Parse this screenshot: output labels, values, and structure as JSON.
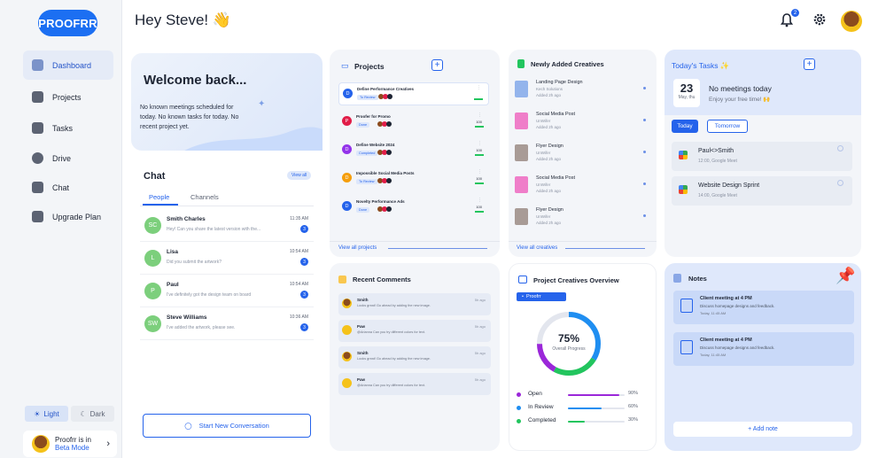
{
  "brand": {
    "logo": "PROOFRR",
    "accent": "#1c6ff2"
  },
  "header": {
    "greeting": "Hey Steve! 👋",
    "notif_count": "2"
  },
  "sidebar": {
    "items": [
      {
        "label": "Dashboard",
        "icon": "dashboard-icon",
        "active": true
      },
      {
        "label": "Projects",
        "icon": "projects-icon"
      },
      {
        "label": "Tasks",
        "icon": "tasks-icon"
      },
      {
        "label": "Drive",
        "icon": "drive-icon"
      },
      {
        "label": "Chat",
        "icon": "chat-icon"
      },
      {
        "label": "Upgrade Plan",
        "icon": "upgrade-icon"
      }
    ],
    "light": "Light",
    "dark": "Dark",
    "beta_line1": "Proofrr is in",
    "beta_line2": "Beta Mode"
  },
  "welcome": {
    "title": "Welcome back...",
    "body": "No known meetings scheduled for today. No known tasks for today. No recent project yet."
  },
  "chat": {
    "title": "Chat",
    "view_all": "View all",
    "tabs": [
      "People",
      "Channels"
    ],
    "messages": [
      {
        "initials": "SC",
        "name": "Smith Charles",
        "text": "Hey! Can you share the latest version with the...",
        "time": "11:35 AM",
        "count": "3",
        "color": "#7ccf7c"
      },
      {
        "initials": "L",
        "name": "Lisa",
        "text": "Did you submit the artwork?",
        "time": "10:54 AM",
        "count": "3",
        "color": "#7ccf7c"
      },
      {
        "initials": "P",
        "name": "Paul",
        "text": "I've definitely got the design team on board",
        "time": "10:54 AM",
        "count": "3",
        "color": "#7ccf7c"
      },
      {
        "initials": "SW",
        "name": "Steve Williams",
        "text": "I've added the artwork, please see.",
        "time": "10:36 AM",
        "count": "3",
        "color": "#7ccf7c"
      }
    ],
    "new_conv": "Start New Conversation"
  },
  "projects": {
    "title": "Projects",
    "view_all": "View all projects",
    "items": [
      {
        "initial": "D",
        "name": "Define Performance Creatives",
        "tag": "To Review",
        "color": "#2563eb",
        "value": ""
      },
      {
        "initial": "P",
        "name": "Proofer for Promo",
        "tag": "Done",
        "color": "#e11d48",
        "value": "100"
      },
      {
        "initial": "D",
        "name": "Define Website 2024",
        "tag": "Completed",
        "color": "#9333ea",
        "value": "100"
      },
      {
        "initial": "D",
        "name": "Impossible Social Media Posts",
        "tag": "To Review",
        "color": "#f59e0b",
        "value": "100"
      },
      {
        "initial": "D",
        "name": "Novelty Performance Ads",
        "tag": "Done",
        "color": "#2563eb",
        "value": "100"
      }
    ]
  },
  "creatives": {
    "title": "Newly Added Creatives",
    "view_all": "View all creatives",
    "items": [
      {
        "name": "Landing Page Design",
        "by": "Kech Solutions",
        "when": "Added 2h ago",
        "color": "#93b4ec"
      },
      {
        "name": "Social Media Post",
        "by": "UnWifer",
        "when": "Added 2h ago",
        "color": "#ef7ec9"
      },
      {
        "name": "Flyer Design",
        "by": "UnWifer",
        "when": "Added 2h ago",
        "color": "#a89b96"
      },
      {
        "name": "Social Media Post",
        "by": "UnWifer",
        "when": "Added 2h ago",
        "color": "#ef7ec9"
      },
      {
        "name": "Flyer Design",
        "by": "UnWifer",
        "when": "Added 2h ago",
        "color": "#a89b96"
      }
    ]
  },
  "tasks": {
    "title": "Today's Tasks ✨",
    "day": "23",
    "day_label": "May, thu",
    "headline": "No meetings today",
    "sub": "Enjoy your free time! 🙌",
    "today": "Today",
    "tomorrow": "Tomorrow",
    "items": [
      {
        "name": "Paul<>Smith",
        "meta": "12:00, Google Meet"
      },
      {
        "name": "Website Design Sprint",
        "meta": "14:00, Google Meet"
      }
    ]
  },
  "comments": {
    "title": "Recent Comments",
    "items": [
      {
        "name": "Smith",
        "text": "Looks great! Go ahead by adding the new image.",
        "time": "5h ago",
        "avatar": "bear"
      },
      {
        "name": "Paw",
        "text": "@Arianna Can you try different colors for text.",
        "time": "5h ago",
        "avatar": "yellow"
      },
      {
        "name": "Smith",
        "text": "Looks great! Go ahead by adding the new image.",
        "time": "5h ago",
        "avatar": "bear"
      },
      {
        "name": "Paw",
        "text": "@Arianna Can you try different colors for text.",
        "time": "5h ago",
        "avatar": "yellow"
      }
    ]
  },
  "overview": {
    "title": "Project Creatives Overview",
    "selector": "Proofrr",
    "percent": "75%",
    "percent_label": "Overall Progress",
    "legend": [
      {
        "label": "Open",
        "value": "90%",
        "fill": 0.9,
        "color": "#9b27d9"
      },
      {
        "label": "In Review",
        "value": "60%",
        "fill": 0.6,
        "color": "#1f8ef1"
      },
      {
        "label": "Completed",
        "value": "30%",
        "fill": 0.3,
        "color": "#22c55e"
      }
    ]
  },
  "notes": {
    "title": "Notes",
    "add": "+ Add note",
    "items": [
      {
        "title": "Client meeting at 4 PM",
        "body": "Discuss homepage designs and feedback.",
        "date": "Today, 11:45 AM"
      },
      {
        "title": "Client meeting at 4 PM",
        "body": "Discuss homepage designs and feedback.",
        "date": "Today, 11:45 AM"
      }
    ]
  }
}
